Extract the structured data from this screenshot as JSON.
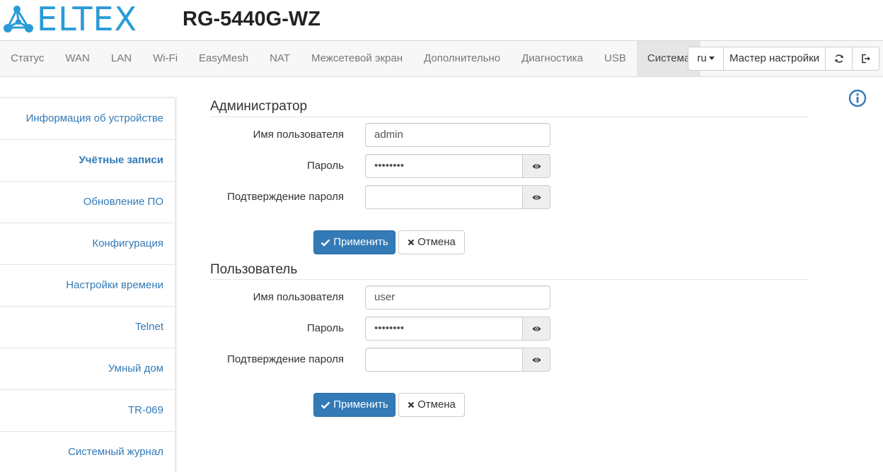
{
  "header": {
    "brand": "ELTEX",
    "model": "RG-5440G-WZ"
  },
  "nav": {
    "tabs": [
      "Статус",
      "WAN",
      "LAN",
      "Wi-Fi",
      "EasyMesh",
      "NAT",
      "Межсетевой экран",
      "Дополнительно",
      "Диагностика",
      "USB",
      "Система"
    ],
    "active_tab": "Система",
    "language": "ru",
    "wizard_label": "Мастер настройки",
    "icons": [
      "refresh-icon",
      "logout-icon"
    ]
  },
  "sidebar": {
    "items": [
      "Информация об устройстве",
      "Учётные записи",
      "Обновление ПО",
      "Конфигурация",
      "Настройки времени",
      "Telnet",
      "Умный дом",
      "TR-069",
      "Системный журнал"
    ],
    "active_item": "Учётные записи"
  },
  "admin": {
    "title": "Администратор",
    "username_label": "Имя пользователя",
    "username_value": "admin",
    "password_label": "Пароль",
    "password_value": "••••••••",
    "confirm_label": "Подтверждение пароля",
    "confirm_value": "",
    "apply_label": "Применить",
    "cancel_label": "Отмена"
  },
  "user": {
    "title": "Пользователь",
    "username_label": "Имя пользователя",
    "username_value": "user",
    "password_label": "Пароль",
    "password_value": "••••••••",
    "confirm_label": "Подтверждение пароля",
    "confirm_value": "",
    "apply_label": "Применить",
    "cancel_label": "Отмена"
  },
  "colors": {
    "brand": "#2a9bd7",
    "link": "#337ab7",
    "primary_button": "#337ab7"
  }
}
